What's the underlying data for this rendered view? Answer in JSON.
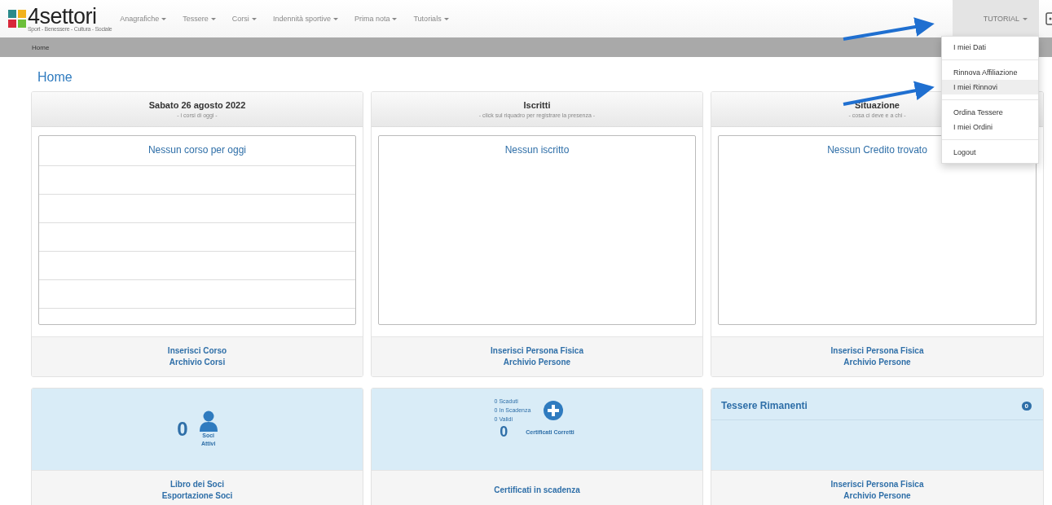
{
  "navbar": {
    "logo": {
      "name": "4settori",
      "tagline": "Sport - Benessere - Cultura - Sociale"
    },
    "menu": [
      {
        "label": "Anagrafiche"
      },
      {
        "label": "Tessere"
      },
      {
        "label": "Corsi"
      },
      {
        "label": "Indennità sportive"
      },
      {
        "label": "Prima nota"
      },
      {
        "label": "Tutorials"
      }
    ],
    "user_menu": {
      "label": "TUTORIAL",
      "expanded": true,
      "groups": [
        [
          {
            "label": "I miei Dati",
            "selected": false
          }
        ],
        [
          {
            "label": "Rinnova Affiliazione",
            "selected": false
          },
          {
            "label": "I miei Rinnovi",
            "selected": true
          }
        ],
        [
          {
            "label": "Ordina Tessere",
            "selected": false
          },
          {
            "label": "I miei Ordini",
            "selected": false
          }
        ],
        [
          {
            "label": "Logout",
            "selected": false
          }
        ]
      ]
    }
  },
  "breadcrumb": "Home",
  "page_title": "Home",
  "top_cards": [
    {
      "kind": "table",
      "title": "Sabato 26 agosto 2022",
      "subtitle": "- i corsi di oggi -",
      "message": "Nessun corso per oggi",
      "links": [
        "Inserisci Corso",
        "Archivio Corsi"
      ]
    },
    {
      "kind": "message",
      "title": "Iscritti",
      "subtitle": "- click sul riquadro per registrare la presenza -",
      "message": "Nessun iscritto",
      "links": [
        "Inserisci Persona Fisica",
        "Archivio Persone"
      ]
    },
    {
      "kind": "message",
      "title": "Situazione",
      "subtitle": "- cosa ci deve e a chi -",
      "message": "Nessun Credito trovato",
      "links": [
        "Inserisci Persona Fisica",
        "Archivio Persone"
      ]
    }
  ],
  "bottom_cards": [
    {
      "kind": "soci",
      "count": "0",
      "label": [
        "Soci",
        "Attivi"
      ],
      "links": [
        "Libro dei Soci",
        "Esportazione Soci"
      ]
    },
    {
      "kind": "certificati",
      "stats": [
        "0 Scaduti",
        "0 In Scadenza",
        "0 Validi"
      ],
      "count": "0",
      "label": [
        "Certificati Corretti"
      ],
      "links": [
        "Certificati in scadenza"
      ]
    },
    {
      "kind": "tessere",
      "title": "Tessere Rimanenti",
      "badge": "0",
      "links": [
        "Inserisci Persona Fisica",
        "Archivio Persone"
      ]
    }
  ]
}
